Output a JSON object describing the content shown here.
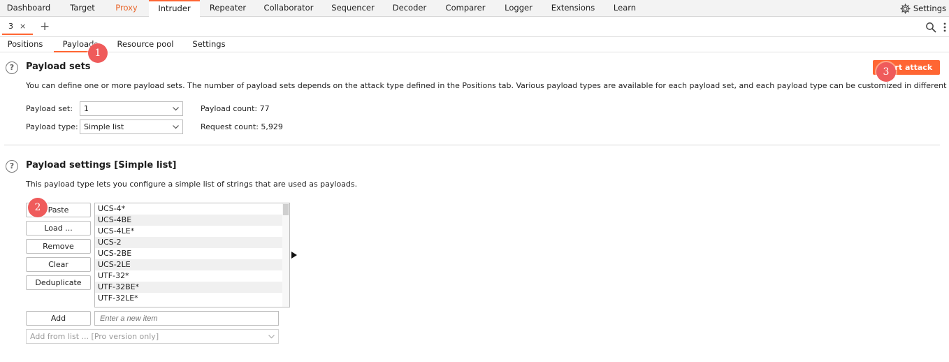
{
  "top_tabs": [
    {
      "label": "Dashboard"
    },
    {
      "label": "Target"
    },
    {
      "label": "Proxy"
    },
    {
      "label": "Intruder"
    },
    {
      "label": "Repeater"
    },
    {
      "label": "Collaborator"
    },
    {
      "label": "Sequencer"
    },
    {
      "label": "Decoder"
    },
    {
      "label": "Comparer"
    },
    {
      "label": "Logger"
    },
    {
      "label": "Extensions"
    },
    {
      "label": "Learn"
    }
  ],
  "top_settings_label": "Settings",
  "instance_tab": {
    "label": "3",
    "close": "×"
  },
  "new_tab": "+",
  "sub_tabs": [
    {
      "label": "Positions"
    },
    {
      "label": "Payloads"
    },
    {
      "label": "Resource pool"
    },
    {
      "label": "Settings"
    }
  ],
  "badges": [
    "1",
    "2",
    "3"
  ],
  "payload_sets": {
    "help": "?",
    "title": "Payload sets",
    "description": "You can define one or more payload sets. The number of payload sets depends on the attack type defined in the Positions tab. Various payload types are available for each payload set, and each payload type can be customized in different ways.",
    "set_label": "Payload set:",
    "set_value": "1",
    "type_label": "Payload type:",
    "type_value": "Simple list",
    "payload_count_label": "Payload count:",
    "payload_count": "77",
    "request_count_label": "Request count:",
    "request_count": "5,929",
    "start_attack": "Start attack"
  },
  "payload_settings": {
    "help": "?",
    "title": "Payload settings [Simple list]",
    "description": "This payload type lets you configure a simple list of strings that are used as payloads.",
    "buttons": {
      "paste": "Paste",
      "load": "Load ...",
      "remove": "Remove",
      "clear": "Clear",
      "deduplicate": "Deduplicate",
      "add": "Add"
    },
    "list_items": [
      "UCS-4*",
      "UCS-4BE",
      "UCS-4LE*",
      "UCS-2",
      "UCS-2BE",
      "UCS-2LE",
      "UTF-32*",
      "UTF-32BE*",
      "UTF-32LE*"
    ],
    "new_item_placeholder": "Enter a new item",
    "add_from_list": "Add from list ... [Pro version only]"
  },
  "colors": {
    "accent": "#ff6633",
    "badge": "#ef5b5b"
  }
}
